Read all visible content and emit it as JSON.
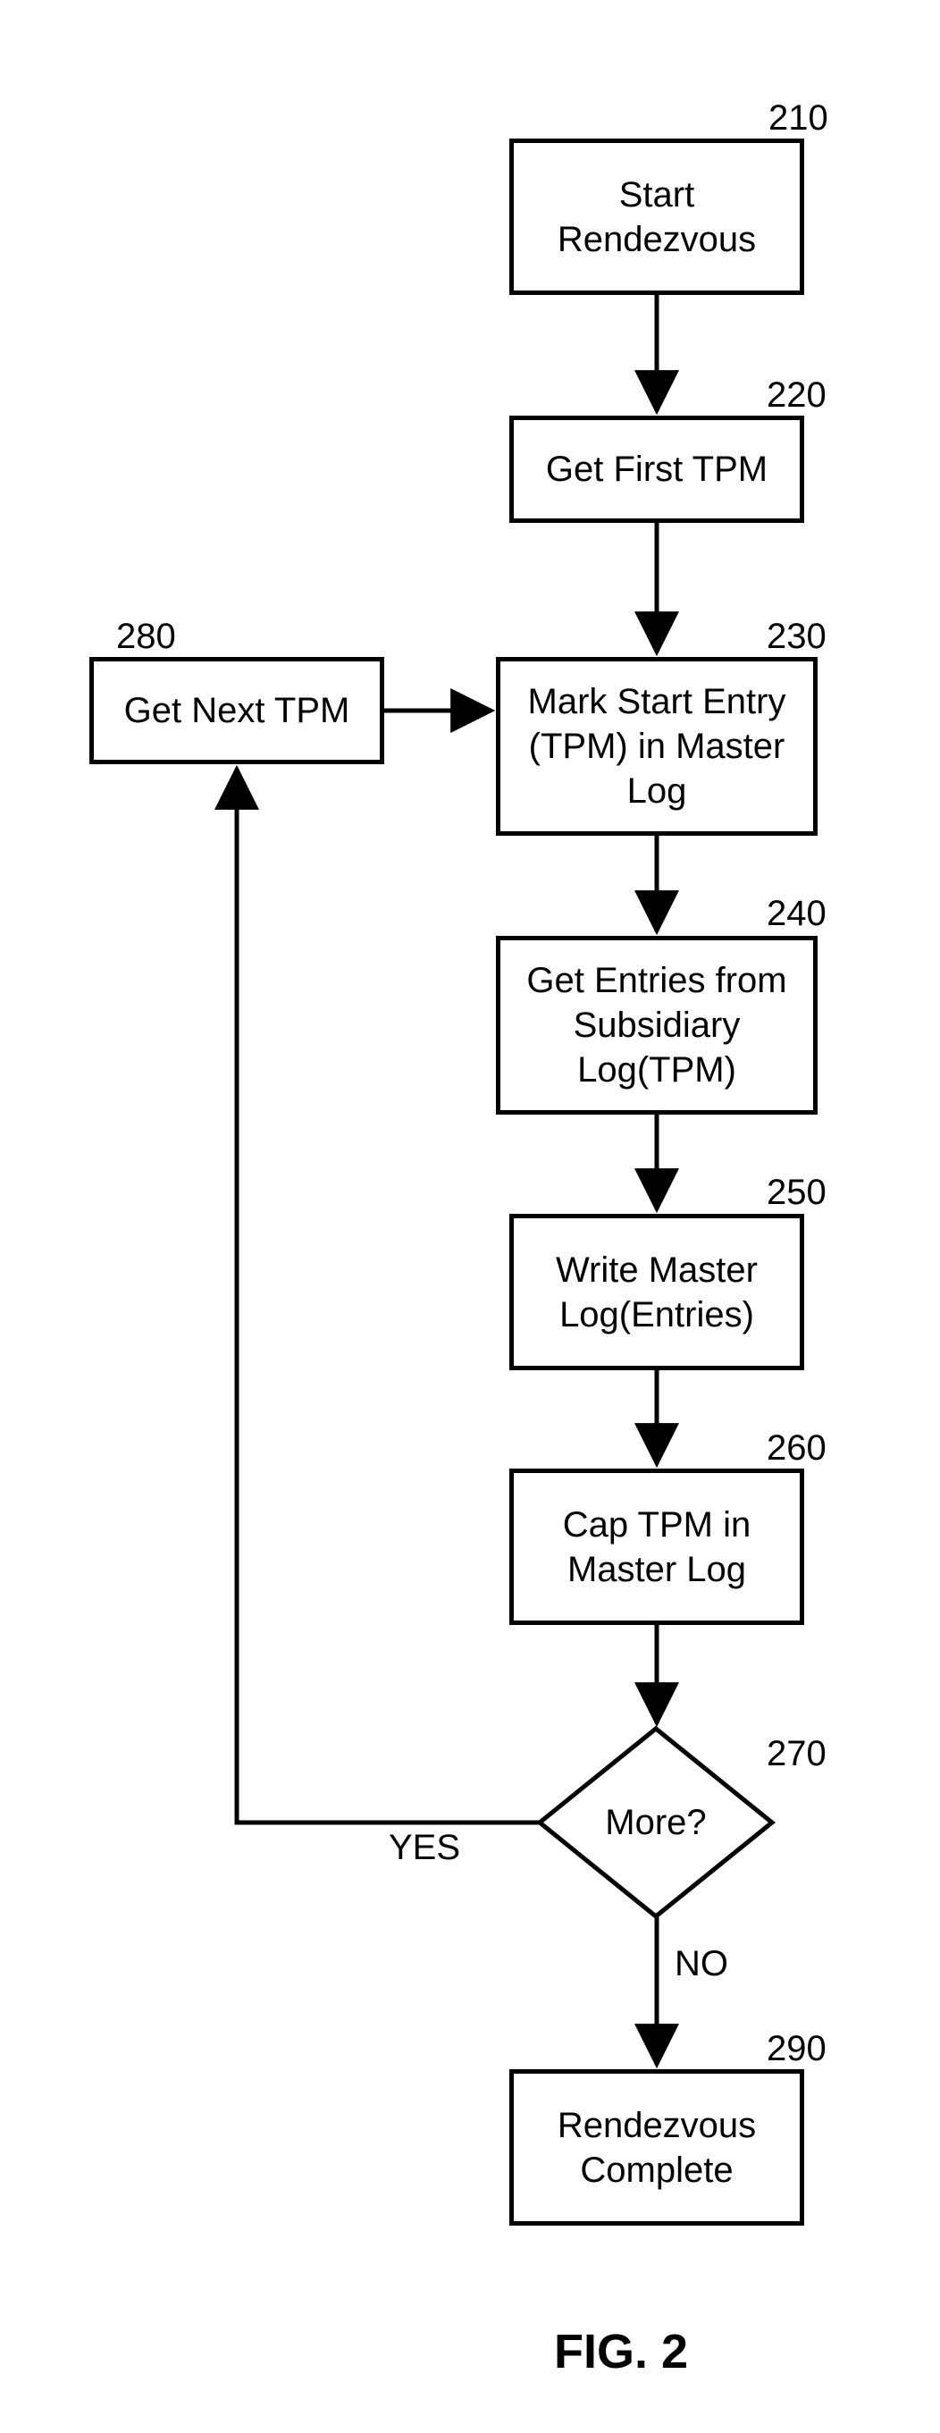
{
  "refs": {
    "start": "210",
    "getfirst": "220",
    "markstart": "230",
    "getentries": "240",
    "writemaster": "250",
    "captpm": "260",
    "more": "270",
    "getnext": "280",
    "complete": "290"
  },
  "nodes": {
    "start": "Start\nRendezvous",
    "getfirst": "Get First TPM",
    "markstart": "Mark Start Entry\n(TPM) in Master\nLog",
    "getentries": "Get Entries from\nSubsidiary\nLog(TPM)",
    "writemaster": "Write Master\nLog(Entries)",
    "captpm": "Cap TPM in\nMaster Log",
    "more": "More?",
    "getnext": "Get Next TPM",
    "complete": "Rendezvous\nComplete"
  },
  "edges": {
    "yes": "YES",
    "no": "NO"
  },
  "figure_label": "FIG. 2"
}
